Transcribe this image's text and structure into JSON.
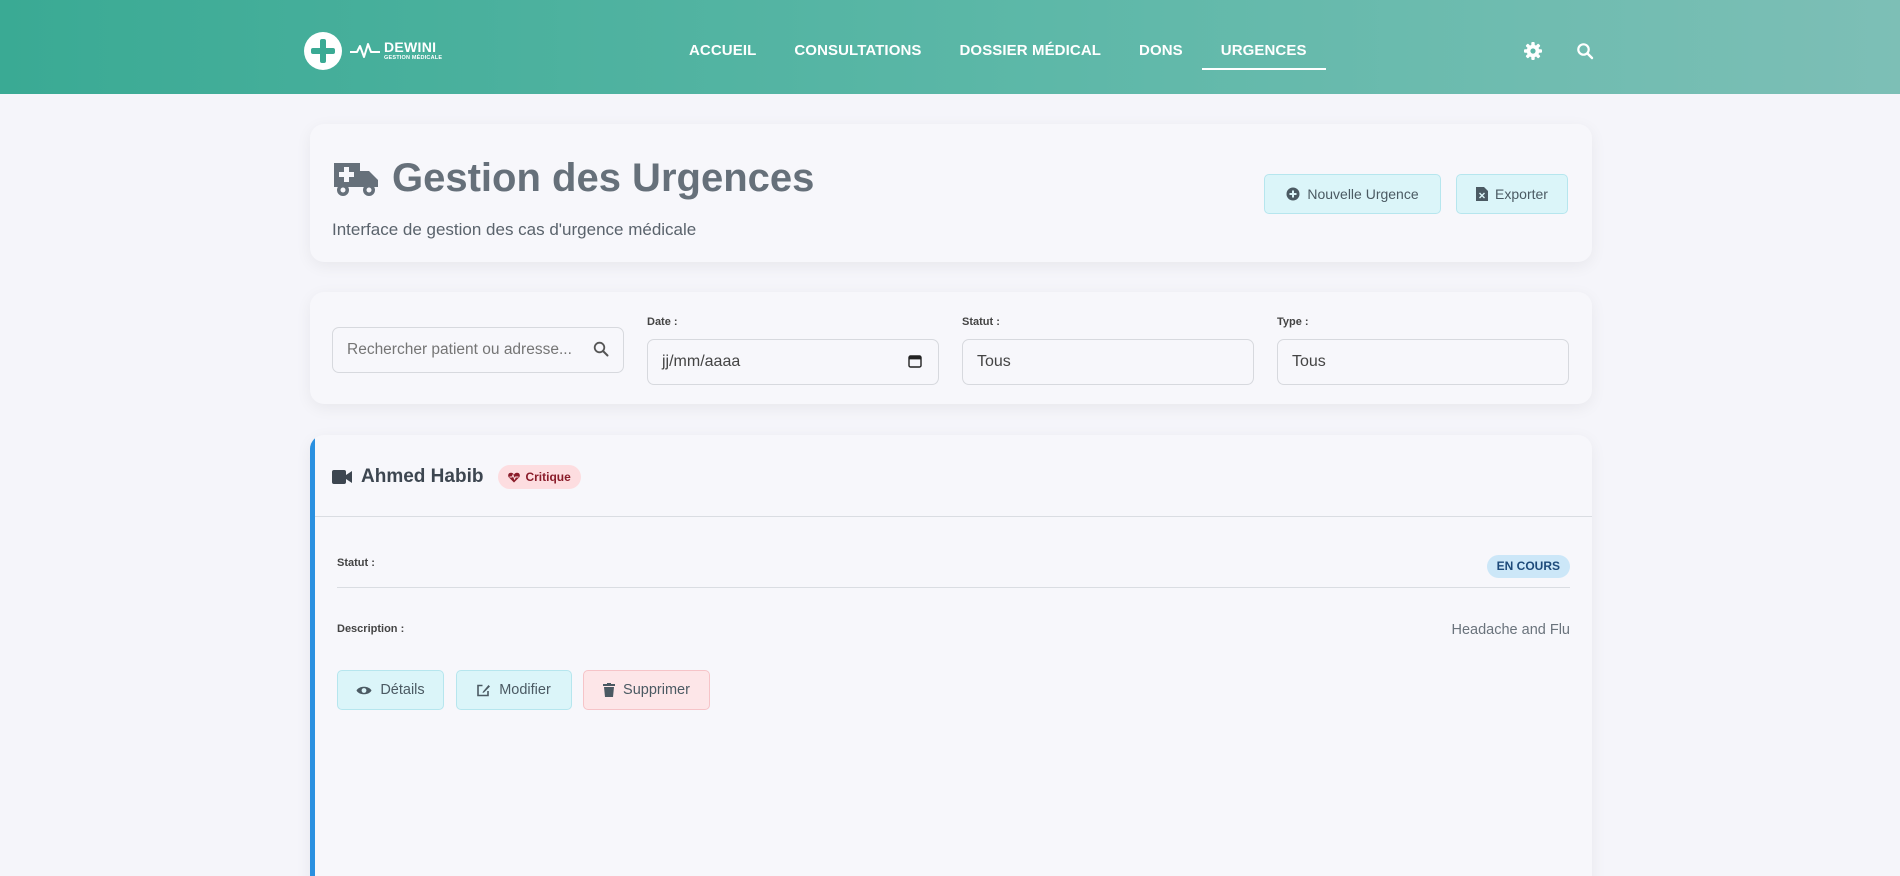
{
  "brand": {
    "name": "DEWINI",
    "tagline": "GESTION MÉDICALE",
    "accent": "#3aaa94"
  },
  "nav": {
    "items": [
      {
        "label": "ACCUEIL"
      },
      {
        "label": "CONSULTATIONS"
      },
      {
        "label": "DOSSIER MÉDICAL"
      },
      {
        "label": "DONS"
      },
      {
        "label": "URGENCES",
        "active": true
      }
    ],
    "icons": [
      "gear-icon",
      "search-icon"
    ]
  },
  "page": {
    "title": "Gestion des Urgences",
    "subtitle": "Interface de gestion des cas d'urgence médicale",
    "title_icon": "ambulance-icon",
    "new_button": "Nouvelle Urgence",
    "export_button": "Exporter"
  },
  "filters": {
    "search_placeholder": "Rechercher patient ou adresse...",
    "date_label": "Date :",
    "date_value": "jj/mm/aaaa",
    "status_label": "Statut :",
    "status_value": "Tous",
    "type_label": "Type :",
    "type_value": "Tous"
  },
  "case": {
    "patient": "Ahmed Habib",
    "severity": "Critique",
    "type_icon": "video-camera-icon",
    "status_label": "Statut :",
    "status_value": "EN COURS",
    "description_label": "Description :",
    "description_value": "Headache and Flu",
    "accent": "#2a90e0",
    "buttons": {
      "details": "Détails",
      "edit": "Modifier",
      "delete": "Supprimer"
    }
  }
}
